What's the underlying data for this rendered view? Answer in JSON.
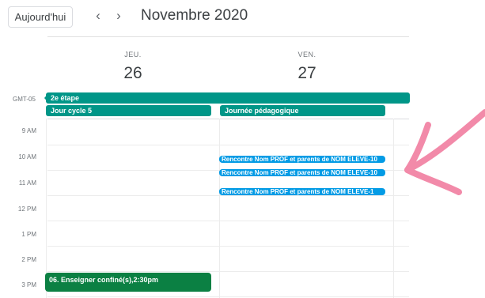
{
  "toolbar": {
    "today_label": "Aujourd'hui",
    "prev_label": "‹",
    "next_label": "›",
    "month_title": "Novembre 2020"
  },
  "days": [
    {
      "dow": "JEU.",
      "num": "26"
    },
    {
      "dow": "VEN.",
      "num": "27"
    }
  ],
  "timezone": "GMT-05",
  "allday_events": {
    "spanning": "2e étape",
    "jeu": "Jour cycle 5",
    "ven": "Journée pédagogique"
  },
  "hours": [
    "9 AM",
    "10 AM",
    "11 AM",
    "12 PM",
    "1 PM",
    "2 PM",
    "3 PM"
  ],
  "events": [
    "Rencontre Nom PROF et parents de NOM ELEVE-10",
    "Rencontre Nom PROF et parents de NOM ELEVE-10",
    "Rencontre Nom PROF et parents de NOM ELEVE-1"
  ],
  "event_jeu": "06. Enseigner confiné(s),2:30pm",
  "colors": {
    "teal": "#009688",
    "green": "#0b8043",
    "blue": "#039be5",
    "arrow": "#f06292"
  }
}
